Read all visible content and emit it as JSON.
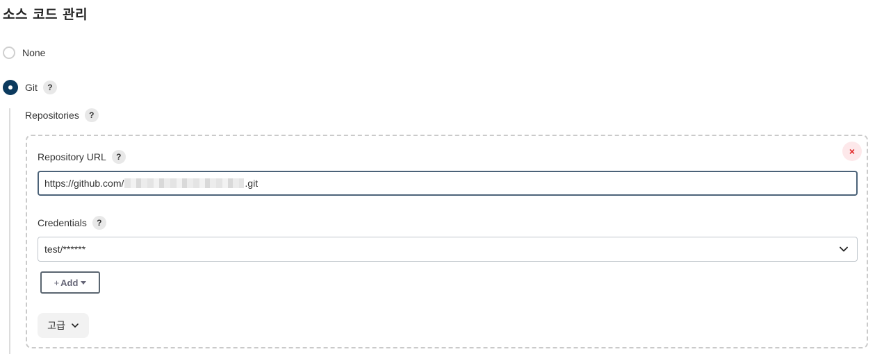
{
  "section": {
    "title": "소스 코드 관리"
  },
  "scm_options": [
    {
      "label": "None",
      "checked": false
    },
    {
      "label": "Git",
      "checked": true
    }
  ],
  "help_glyph": "?",
  "repositories": {
    "label": "Repositories",
    "delete_icon": "×",
    "url_label": "Repository URL",
    "url_value_prefix": "https://github.com/",
    "url_value_suffix": ".git",
    "credentials_label": "Credentials",
    "credentials_value": "test/******",
    "add_button_plus": "+",
    "add_button_label": "Add",
    "advanced_button_label": "고급"
  },
  "colors": {
    "accent": "#0b3a5e",
    "delete_bg": "#fde8ea",
    "delete_fg": "#e02020"
  }
}
